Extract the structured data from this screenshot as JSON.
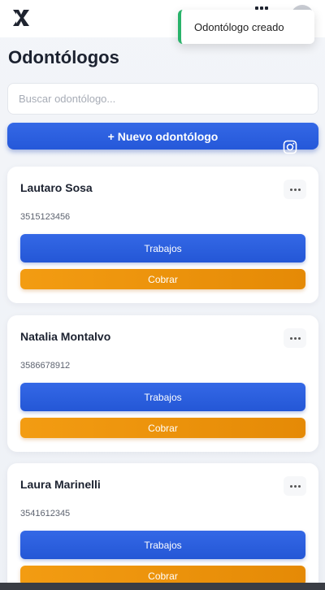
{
  "toast": {
    "message": "Odontólogo creado",
    "accent": "#29b36a"
  },
  "header": {
    "logo_icon": "app-logo-icon",
    "menu_icon": "grid-icon",
    "avatar_icon": "avatar"
  },
  "page": {
    "title": "Odontólogos",
    "search_placeholder": "Buscar odontólogo...",
    "new_button_label": "+ Nuevo odontólogo"
  },
  "colors": {
    "primary": "#2f63e3",
    "secondary": "#f0950c"
  },
  "dentists": [
    {
      "name": "Lautaro Sosa",
      "phone": "3515123456",
      "jobs_label": "Trabajos",
      "charge_label": "Cobrar"
    },
    {
      "name": "Natalia Montalvo",
      "phone": "3586678912",
      "jobs_label": "Trabajos",
      "charge_label": "Cobrar"
    },
    {
      "name": "Laura Marinelli",
      "phone": "3541612345",
      "jobs_label": "Trabajos",
      "charge_label": "Cobrar"
    }
  ]
}
